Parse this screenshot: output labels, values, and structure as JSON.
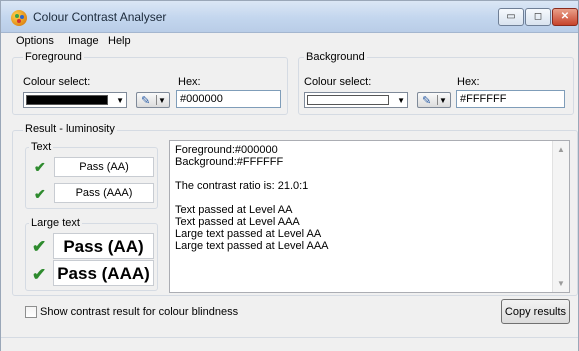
{
  "window": {
    "title": "Colour Contrast Analyser",
    "min_glyph": "▭",
    "max_glyph": "◻",
    "close_glyph": "✕"
  },
  "menu": {
    "items": [
      "Options",
      "Image",
      "Help"
    ]
  },
  "foreground": {
    "group_label": "Foreground",
    "colour_select_label": "Colour select:",
    "swatch_color": "#000000",
    "hex_label": "Hex:",
    "hex_value": "#000000"
  },
  "background": {
    "group_label": "Background",
    "colour_select_label": "Colour select:",
    "swatch_color": "#FFFFFF",
    "hex_label": "Hex:",
    "hex_value": "#FFFFFF"
  },
  "result": {
    "group_label": "Result - luminosity",
    "text_group": {
      "label": "Text",
      "aa": "Pass (AA)",
      "aaa": "Pass (AAA)"
    },
    "large_text_group": {
      "label": "Large text",
      "aa": "Pass (AA)",
      "aaa": "Pass (AAA)"
    },
    "lines": [
      "Foreground:#000000",
      "Background:#FFFFFF",
      "",
      "The contrast ratio is: 21.0:1",
      "",
      "Text passed at Level AA",
      "Text passed at Level AAA",
      "Large text passed at Level AA",
      "Large text passed at Level AAA"
    ]
  },
  "options": {
    "colour_blindness_label": "Show contrast result for colour blindness",
    "colour_blindness_checked": false
  },
  "actions": {
    "copy_label": "Copy results"
  },
  "icons": {
    "app": "app-palette-icon",
    "check": "checkmark-icon",
    "picker": "eyedropper-icon"
  },
  "colors": {
    "check": "#2E8B2E",
    "titlebar": "#C3D6EE"
  }
}
